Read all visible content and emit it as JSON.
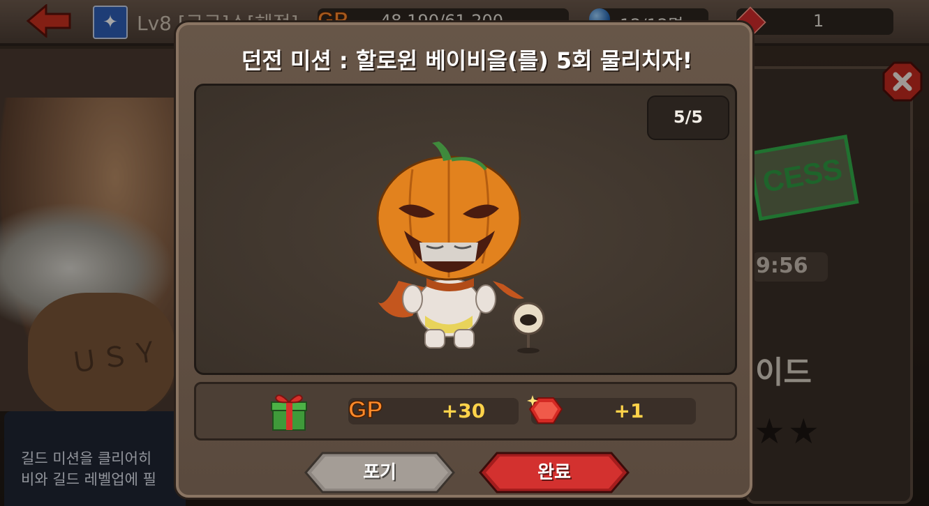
{
  "background": {
    "top_bar": {
      "level_text": "Lv8 [구구]소[헤적]",
      "gp_label": "GP",
      "gp_value": "48,190/61,200",
      "members": "12/12명",
      "gems": "1"
    },
    "timer": "9:56",
    "stamp_text": "CESS",
    "side_label": "이드",
    "stars": "★★",
    "left_panel": {
      "line1": "길드 미션을 클리어히",
      "line2": "비와 길드 레벨업에 필"
    },
    "body_tattoo": "ＵＳＹ"
  },
  "modal": {
    "title": "던전 미션 : 할로윈 베이비을(를) 5회 물리치자!",
    "progress": "5/5",
    "rewards": {
      "gp_label": "GP",
      "gp_amount": "+30",
      "gem_amount": "+1"
    },
    "buttons": {
      "give_up": "포기",
      "complete": "완료"
    }
  },
  "colors": {
    "complete_button": "#c8292a",
    "giveup_button": "#8c8580",
    "reward_text": "#ffd34a",
    "gp_orange": "#ff8a2a"
  },
  "icons": [
    "back-arrow-icon",
    "guild-emblem-icon",
    "member-orb-icon",
    "gem-icon",
    "close-icon",
    "gift-icon",
    "ruby-gem-icon",
    "target-sign-icon"
  ]
}
